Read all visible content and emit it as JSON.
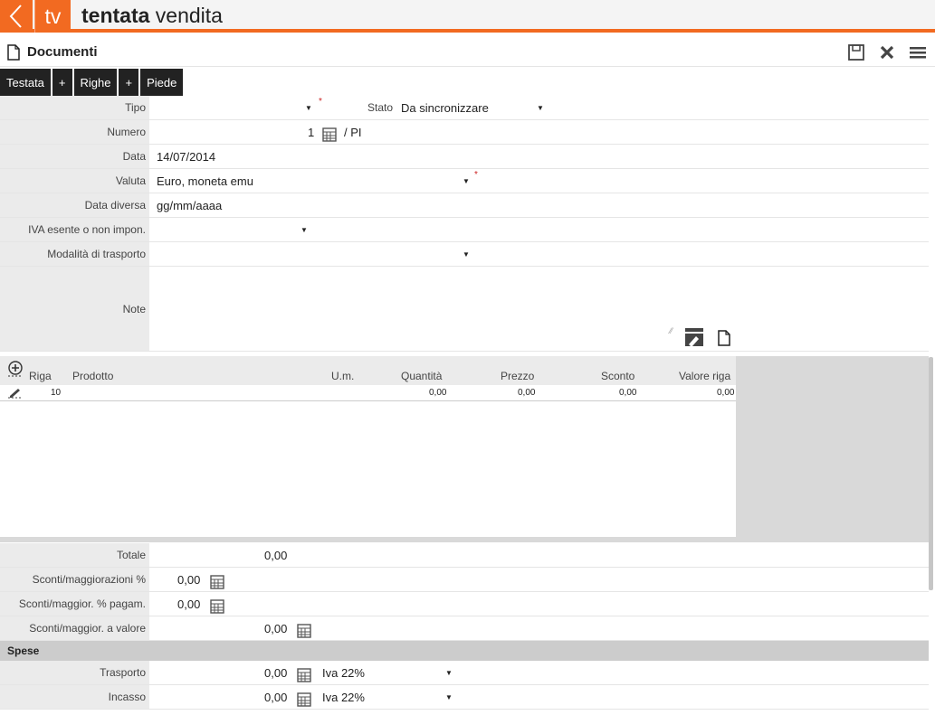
{
  "app": {
    "logo_text": "tv",
    "brand_bold": "tentata",
    "brand_light": " vendita"
  },
  "header": {
    "title": "Documenti"
  },
  "tabs": [
    "Testata",
    "+",
    "Righe",
    "+",
    "Piede"
  ],
  "form": {
    "tipo_label": "Tipo",
    "stato_label": "Stato",
    "stato_value": "Da sincronizzare",
    "numero_label": "Numero",
    "numero_value": "1",
    "numero_suffix": "/ PI",
    "data_label": "Data",
    "data_value": "14/07/2014",
    "valuta_label": "Valuta",
    "valuta_value": "Euro, moneta emu",
    "data_diversa_label": "Data diversa",
    "data_diversa_value": "gg/mm/aaaa",
    "iva_label": "IVA esente o non impon.",
    "trasporto_label": "Modalità di trasporto",
    "note_label": "Note"
  },
  "grid": {
    "columns": [
      "Riga",
      "Prodotto",
      "U.m.",
      "Quantità",
      "Prezzo",
      "Sconto",
      "Valore riga"
    ],
    "rows": [
      {
        "riga": "10",
        "quantita": "0,00",
        "prezzo": "0,00",
        "sconto": "0,00",
        "valore": "0,00"
      }
    ]
  },
  "totals": {
    "totale_label": "Totale",
    "totale_value": "0,00",
    "sconti_perc_label": "Sconti/maggiorazioni %",
    "sconti_perc_value": "0,00",
    "sconti_pagam_label": "Sconti/maggior. % pagam.",
    "sconti_pagam_value": "0,00",
    "sconti_valore_label": "Sconti/maggior. a valore",
    "sconti_valore_value": "0,00",
    "spese_label": "Spese",
    "trasporto_label": "Trasporto",
    "trasporto_value": "0,00",
    "trasporto_iva": "Iva 22%",
    "incasso_label": "Incasso",
    "incasso_value": "0,00",
    "incasso_iva": "Iva 22%"
  },
  "colors": {
    "accent": "#f26a21",
    "tab_bg": "#222222",
    "label_bg": "#ebebeb"
  }
}
